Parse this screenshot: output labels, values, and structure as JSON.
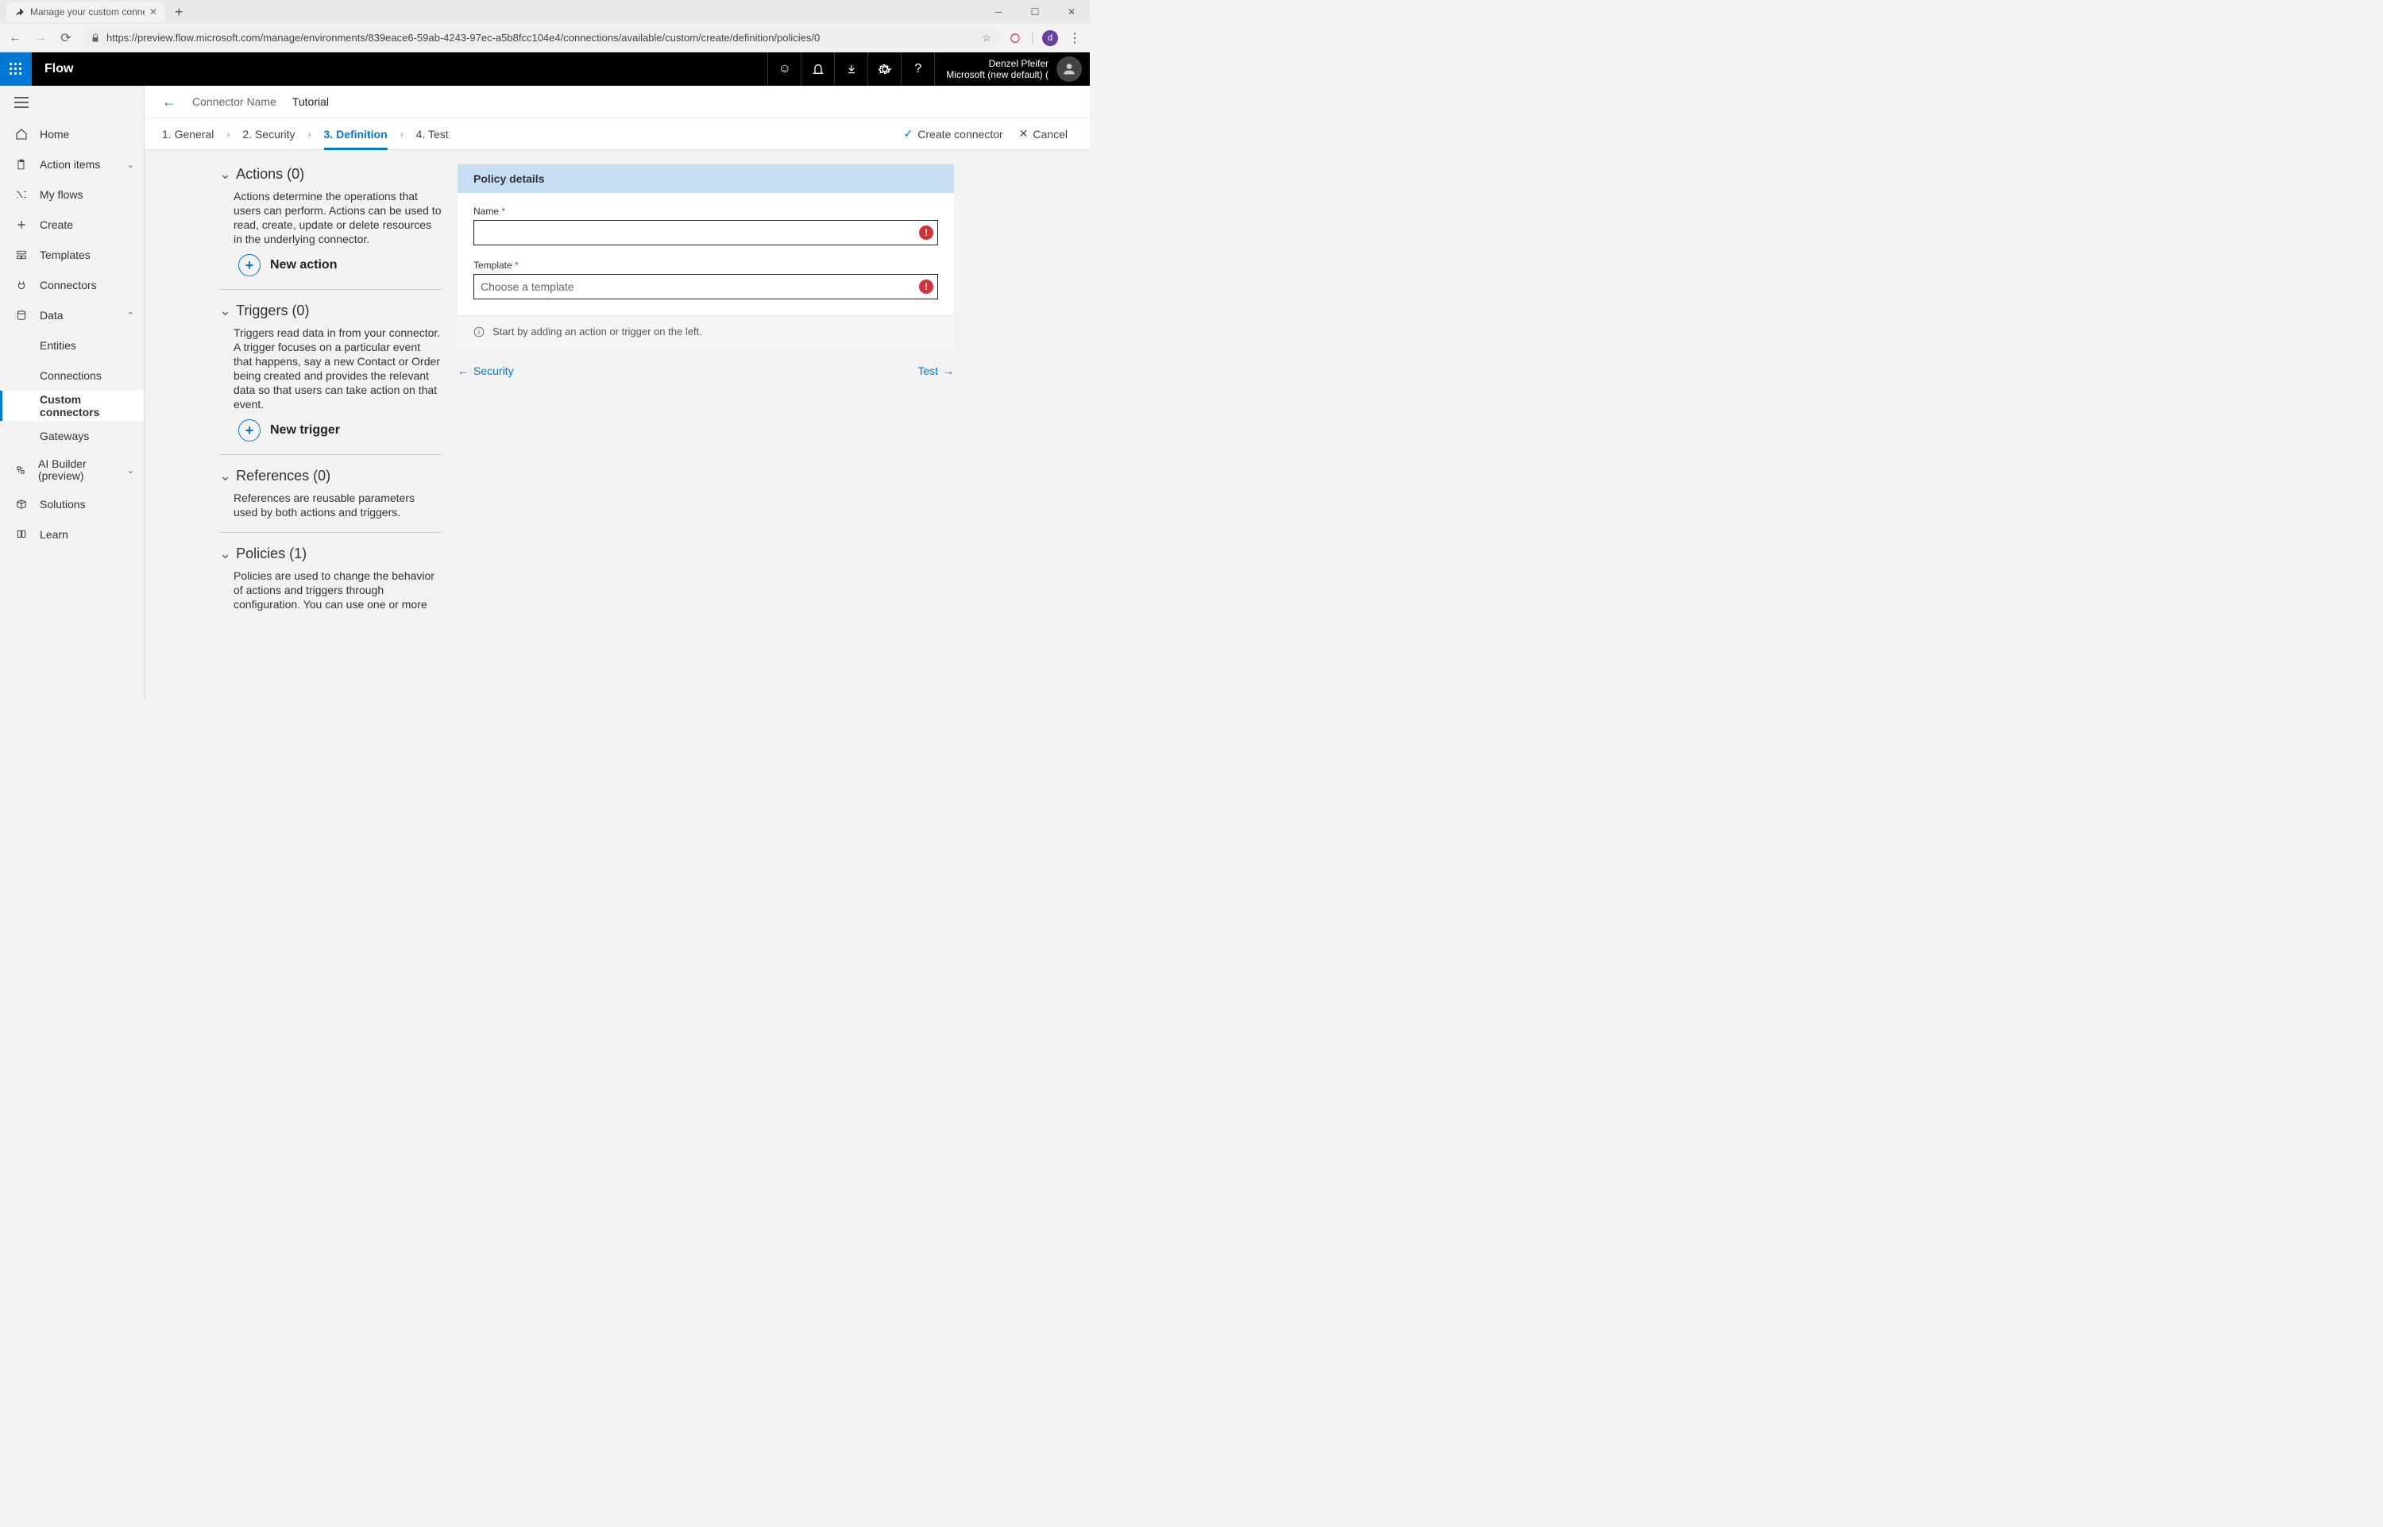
{
  "browser": {
    "tab_title": "Manage your custom connectors",
    "url": "https://preview.flow.microsoft.com/manage/environments/839eace6-59ab-4243-97ec-a5b8fcc104e4/connections/available/custom/create/definition/policies/0",
    "ext_initial": "d"
  },
  "header": {
    "app_name": "Flow",
    "user_name": "Denzel Pfeifer",
    "tenant": "Microsoft (new default) ("
  },
  "sidebar": {
    "items": [
      {
        "label": "Home",
        "icon": "home"
      },
      {
        "label": "Action items",
        "icon": "clipboard",
        "expandable": true
      },
      {
        "label": "My flows",
        "icon": "flows"
      },
      {
        "label": "Create",
        "icon": "plus"
      },
      {
        "label": "Templates",
        "icon": "template"
      },
      {
        "label": "Connectors",
        "icon": "connector"
      },
      {
        "label": "Data",
        "icon": "data",
        "expandable": true,
        "expanded": true,
        "children": [
          {
            "label": "Entities"
          },
          {
            "label": "Connections"
          },
          {
            "label": "Custom connectors",
            "active": true
          },
          {
            "label": "Gateways"
          }
        ]
      },
      {
        "label": "AI Builder (preview)",
        "icon": "ai",
        "expandable": true
      },
      {
        "label": "Solutions",
        "icon": "solutions"
      },
      {
        "label": "Learn",
        "icon": "book"
      }
    ]
  },
  "connector": {
    "label": "Connector Name",
    "value": "Tutorial"
  },
  "steps": {
    "s1": "1. General",
    "s2": "2. Security",
    "s3": "3. Definition",
    "s4": "4. Test",
    "create": "Create connector",
    "cancel": "Cancel"
  },
  "definition": {
    "actions": {
      "title": "Actions (0)",
      "desc": "Actions determine the operations that users can perform. Actions can be used to read, create, update or delete resources in the underlying connector.",
      "button": "New action"
    },
    "triggers": {
      "title": "Triggers (0)",
      "desc": "Triggers read data in from your connector. A trigger focuses on a particular event that happens, say a new Contact or Order being created and provides the relevant data so that users can take action on that event.",
      "button": "New trigger"
    },
    "references": {
      "title": "References (0)",
      "desc": "References are reusable parameters used by both actions and triggers."
    },
    "policies": {
      "title": "Policies (1)",
      "desc": "Policies are used to change the behavior of actions and triggers through configuration. You can use one or more"
    }
  },
  "policy": {
    "header": "Policy details",
    "name_label": "Name",
    "name_value": "",
    "template_label": "Template",
    "template_placeholder": "Choose a template",
    "info": "Start by adding an action or trigger on the left."
  },
  "bottom_nav": {
    "prev": "Security",
    "next": "Test"
  }
}
